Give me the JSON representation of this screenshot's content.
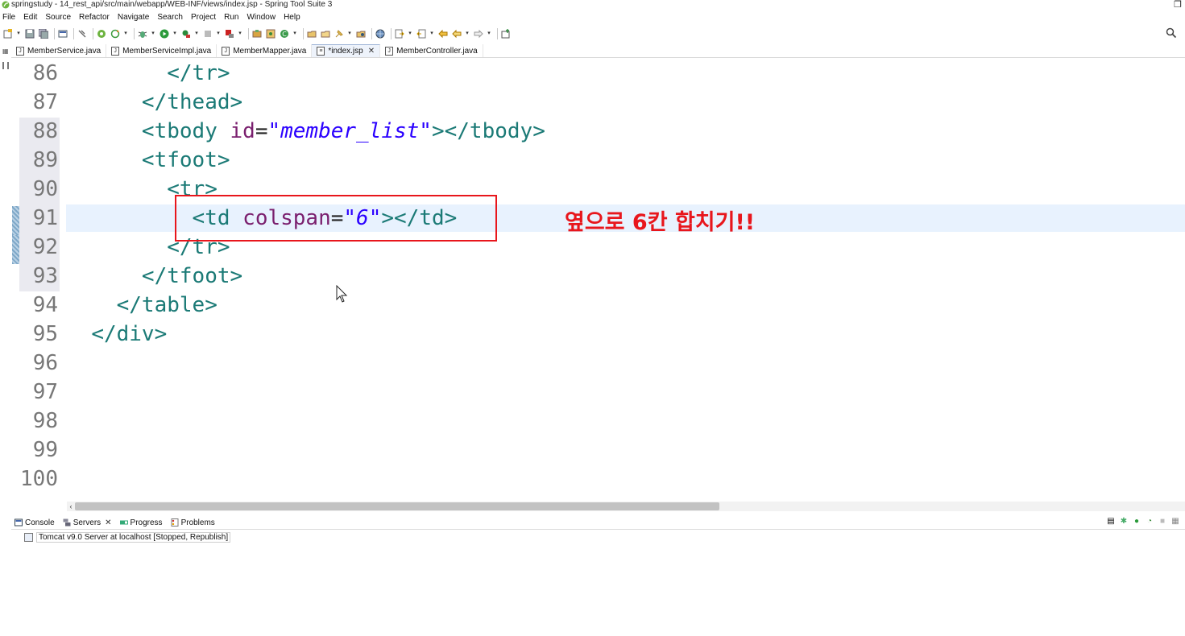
{
  "window": {
    "title": "springstudy - 14_rest_api/src/main/webapp/WEB-INF/views/index.jsp - Spring Tool Suite 3"
  },
  "menu": [
    "File",
    "Edit",
    "Source",
    "Refactor",
    "Navigate",
    "Search",
    "Project",
    "Run",
    "Window",
    "Help"
  ],
  "editor_tabs": [
    {
      "label": "MemberService.java",
      "active": false
    },
    {
      "label": "MemberServiceImpl.java",
      "active": false
    },
    {
      "label": "MemberMapper.java",
      "active": false
    },
    {
      "label": "*index.jsp",
      "active": true
    },
    {
      "label": "MemberController.java",
      "active": false
    }
  ],
  "code_lines": [
    {
      "num": "86",
      "text": "        </tr>"
    },
    {
      "num": "87",
      "text": "      </thead>"
    },
    {
      "num": "88",
      "text": "      <tbody id=\"member_list\"></tbody>"
    },
    {
      "num": "89",
      "text": "      <tfoot>"
    },
    {
      "num": "90",
      "text": "        <tr>"
    },
    {
      "num": "91",
      "text": "          <td colspan=\"6\"></td>"
    },
    {
      "num": "92",
      "text": "        </tr>"
    },
    {
      "num": "93",
      "text": "      </tfoot>"
    },
    {
      "num": "94",
      "text": "    </table>"
    },
    {
      "num": "95",
      "text": "  </div>"
    },
    {
      "num": "96",
      "text": ""
    },
    {
      "num": "97",
      "text": ""
    },
    {
      "num": "98",
      "text": ""
    },
    {
      "num": "99",
      "text": ""
    },
    {
      "num": "100",
      "text": ""
    }
  ],
  "current_line": "91",
  "annotation": "옆으로 6칸 합치기!!",
  "bottom_panel": {
    "tabs": [
      {
        "label": "Console"
      },
      {
        "label": "Servers"
      },
      {
        "label": "Progress"
      },
      {
        "label": "Problems"
      }
    ],
    "server_name": "Tomcat v9.0 Server at localhost",
    "server_status": "[Stopped, Republish]"
  },
  "colors": {
    "tag": "#1b7a76",
    "attribute": "#7a1f6e",
    "string": "#2a00ff",
    "annotation": "#e8161c",
    "current_line_bg": "#e8f2fe"
  },
  "icons": {
    "app": "spring-leaf-icon",
    "search": "search-icon"
  }
}
